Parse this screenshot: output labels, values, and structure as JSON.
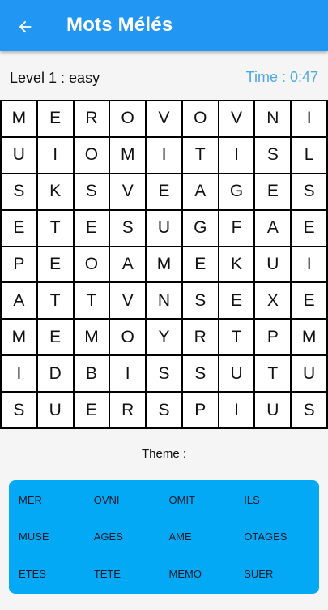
{
  "appbar": {
    "title": "Mots Mélés",
    "back_icon": "arrow-left-icon"
  },
  "status": {
    "level": "Level 1 : easy",
    "timer": "Time : 0:47"
  },
  "grid": {
    "rows": [
      [
        "M",
        "E",
        "R",
        "O",
        "V",
        "O",
        "V",
        "N",
        "I"
      ],
      [
        "U",
        "I",
        "O",
        "M",
        "I",
        "T",
        "I",
        "S",
        "L"
      ],
      [
        "S",
        "K",
        "S",
        "V",
        "E",
        "A",
        "G",
        "E",
        "S"
      ],
      [
        "E",
        "T",
        "E",
        "S",
        "U",
        "G",
        "F",
        "A",
        "E"
      ],
      [
        "P",
        "E",
        "O",
        "A",
        "M",
        "E",
        "K",
        "U",
        "I"
      ],
      [
        "A",
        "T",
        "T",
        "V",
        "N",
        "S",
        "E",
        "X",
        "E"
      ],
      [
        "M",
        "E",
        "M",
        "O",
        "Y",
        "R",
        "T",
        "P",
        "M"
      ],
      [
        "I",
        "D",
        "B",
        "I",
        "S",
        "S",
        "U",
        "T",
        "U"
      ],
      [
        "S",
        "U",
        "E",
        "R",
        "S",
        "P",
        "I",
        "U",
        "S"
      ]
    ]
  },
  "theme": {
    "label": "Theme :"
  },
  "words": [
    "MER",
    "OVNI",
    "OMIT",
    "ILS",
    "MUSE",
    "AGES",
    "AME",
    "OTAGES",
    "ETES",
    "TETE",
    "MEMO",
    "SUER"
  ],
  "colors": {
    "appbar": "#2196f3",
    "panel": "#03a9f4",
    "timer": "#52a8e6"
  }
}
